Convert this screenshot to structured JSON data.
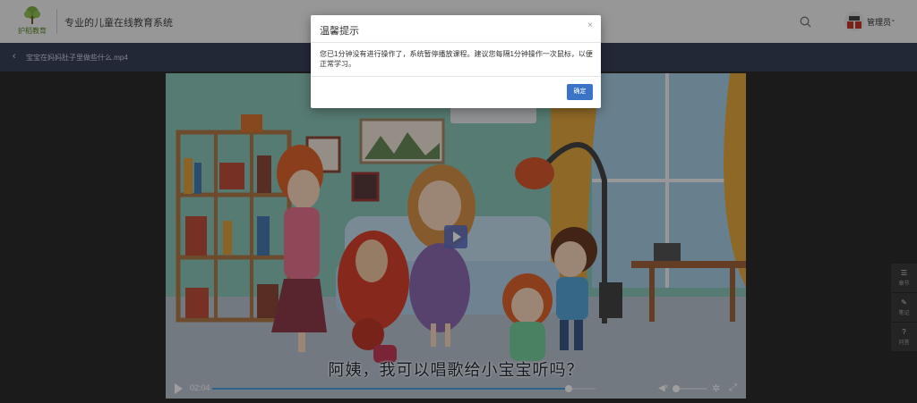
{
  "header": {
    "logo_text": "护稻教育",
    "site_title": "专业的儿童在线教育系统",
    "user_name": "管理员"
  },
  "breadcrumb": {
    "video_title": "宝宝在妈妈肚子里做些什么.mp4"
  },
  "player": {
    "subtitle": "阿姨，我可以唱歌给小宝宝听吗？",
    "current_time": "02:04",
    "progress": 0.93,
    "volume": 0.0
  },
  "side_toolbar": {
    "items": [
      {
        "icon": "list-icon",
        "label": "章节"
      },
      {
        "icon": "pencil-icon",
        "label": "笔记"
      },
      {
        "icon": "question-icon",
        "label": "问答"
      }
    ]
  },
  "modal": {
    "title": "温馨提示",
    "message": "您已1分钟没有进行操作了，系统暂停播放课程。建议您每隔1分钟操作一次鼠标，以便正常学习。",
    "ok_label": "确定"
  },
  "colors": {
    "crumb_bar": "#39415a",
    "primary_button": "#3b74c6",
    "progress": "#4aa3df"
  }
}
